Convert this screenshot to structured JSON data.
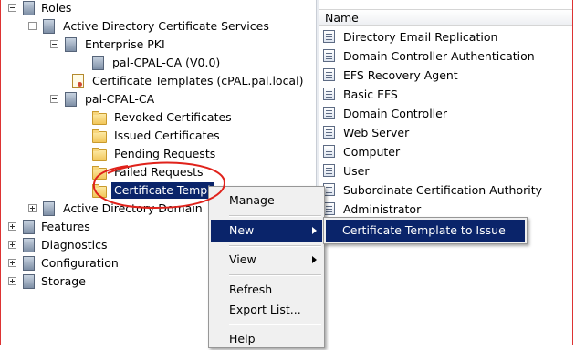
{
  "tree": {
    "roles": "Roles",
    "adcs": "Active Directory Certificate Services",
    "enterprise_pki": "Enterprise PKI",
    "pal_ca_v0": "pal-CPAL-CA (V0.0)",
    "cert_templates_domain": "Certificate Templates (cPAL.pal.local)",
    "pal_ca": "pal-CPAL-CA",
    "revoked": "Revoked Certificates",
    "issued": "Issued Certificates",
    "pending": "Pending Requests",
    "failed": "Failed Requests",
    "cert_templates": "Certificate Templ",
    "ad_domain": "Active Directory Domain",
    "features": "Features",
    "diagnostics": "Diagnostics",
    "configuration": "Configuration",
    "storage": "Storage"
  },
  "list": {
    "column_name": "Name",
    "items": [
      "Directory Email Replication",
      "Domain Controller Authentication",
      "EFS Recovery Agent",
      "Basic EFS",
      "Domain Controller",
      "Web Server",
      "Computer",
      "User",
      "Subordinate Certification Authority",
      "Administrator"
    ]
  },
  "context_menu": {
    "manage": "Manage",
    "new": "New",
    "view": "View",
    "refresh": "Refresh",
    "export_list": "Export List...",
    "help": "Help"
  },
  "submenu": {
    "item": "Certificate Template to Issue"
  },
  "colors": {
    "highlight": "#0a246a",
    "annotation": "#e0221b"
  }
}
